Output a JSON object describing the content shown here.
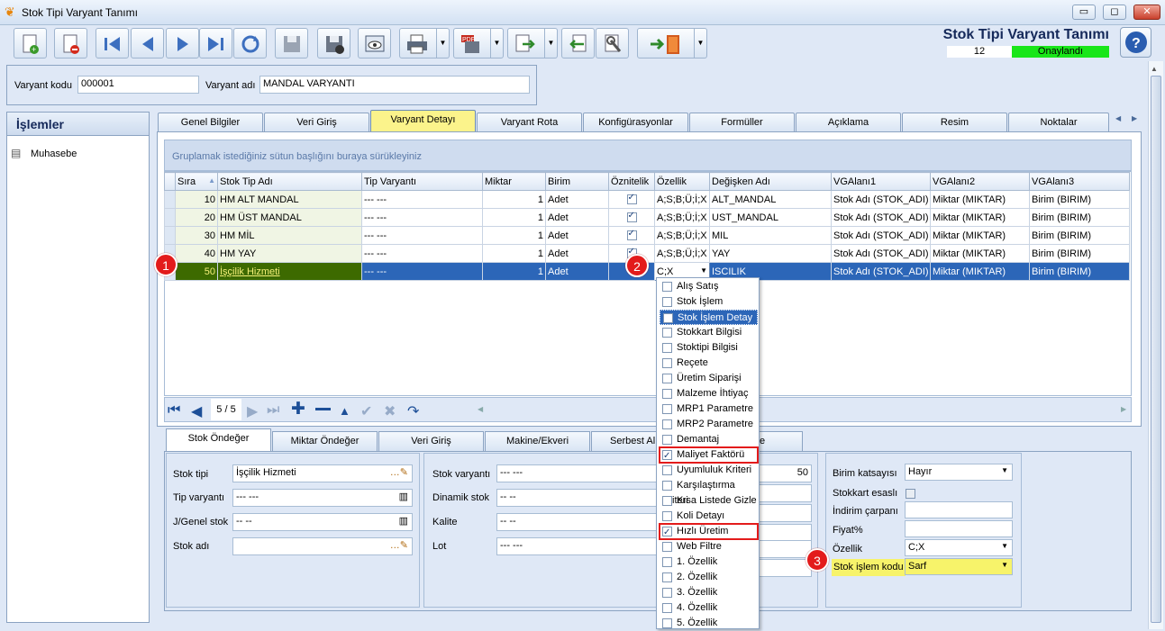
{
  "window": {
    "title": "Stok Tipi Varyant Tanımı",
    "min": "▭",
    "restore": "◻",
    "close": "✕"
  },
  "header": {
    "title": "Stok Tipi Varyant Tanımı",
    "count": "12",
    "status": "Onaylandı",
    "status_color": "#19e619"
  },
  "form": {
    "kod_label": "Varyant kodu",
    "kod_value": "000001",
    "adi_label": "Varyant adı",
    "adi_value": "MANDAL VARYANTI"
  },
  "sidebar": {
    "title": "İşlemler",
    "item": "Muhasebe"
  },
  "tabs": [
    "Genel Bilgiler",
    "Veri Giriş",
    "Varyant Detayı",
    "Varyant Rota",
    "Konfigürasyonlar",
    "Formüller",
    "Açıklama",
    "Resim",
    "Noktalar"
  ],
  "grid": {
    "group_hint": "Gruplamak istediğiniz sütun başlığını buraya sürükleyiniz",
    "columns": [
      "Sıra",
      "Stok Tip Adı",
      "Tip Varyantı",
      "Miktar",
      "Birim",
      "Öznitelik",
      "Özellik",
      "Değişken Adı",
      "VGAlanı1",
      "VGAlanı2",
      "VGAlanı3"
    ],
    "rows": [
      {
        "sira": "10",
        "ad": "HM ALT MANDAL",
        "tip": "--- ---",
        "miktar": "1",
        "birim": "Adet",
        "oz": "A;S;B;Ü;İ;X",
        "deg": "ALT_MANDAL",
        "vg1": "Stok Adı (STOK_ADI)",
        "vg2": "Miktar (MIKTAR)",
        "vg3": "Birim (BIRIM)"
      },
      {
        "sira": "20",
        "ad": "HM ÜST MANDAL",
        "tip": "--- ---",
        "miktar": "1",
        "birim": "Adet",
        "oz": "A;S;B;Ü;İ;X",
        "deg": "UST_MANDAL",
        "vg1": "Stok Adı (STOK_ADI)",
        "vg2": "Miktar (MIKTAR)",
        "vg3": "Birim (BIRIM)"
      },
      {
        "sira": "30",
        "ad": "HM MİL",
        "tip": "--- ---",
        "miktar": "1",
        "birim": "Adet",
        "oz": "A;S;B;Ü;İ;X",
        "deg": "MIL",
        "vg1": "Stok Adı (STOK_ADI)",
        "vg2": "Miktar (MIKTAR)",
        "vg3": "Birim (BIRIM)"
      },
      {
        "sira": "40",
        "ad": "HM YAY",
        "tip": "--- ---",
        "miktar": "1",
        "birim": "Adet",
        "oz": "A;S;B;Ü;İ;X",
        "deg": "YAY",
        "vg1": "Stok Adı (STOK_ADI)",
        "vg2": "Miktar (MIKTAR)",
        "vg3": "Birim (BIRIM)"
      },
      {
        "sira": "50",
        "ad": "İşçilik Hizmeti",
        "tip": "--- ---",
        "miktar": "1",
        "birim": "Adet",
        "oz": "C;X",
        "deg": "ISCILIK",
        "vg1": "Stok Adı (STOK_ADI)",
        "vg2": "Miktar (MIKTAR)",
        "vg3": "Birim (BIRIM)"
      }
    ],
    "pager": "5 / 5"
  },
  "dropdown": [
    {
      "label": "Alış Satış",
      "checked": false
    },
    {
      "label": "Stok İşlem",
      "checked": false
    },
    {
      "label": "Stok İşlem Detay",
      "checked": false,
      "hl": true
    },
    {
      "label": "Stokkart Bilgisi",
      "checked": false
    },
    {
      "label": "Stoktipi Bilgisi",
      "checked": false
    },
    {
      "label": "Reçete",
      "checked": false
    },
    {
      "label": "Üretim Siparişi",
      "checked": false
    },
    {
      "label": "Malzeme İhtiyaç",
      "checked": false
    },
    {
      "label": "MRP1 Parametre",
      "checked": false
    },
    {
      "label": "MRP2 Parametre",
      "checked": false
    },
    {
      "label": "Demantaj",
      "checked": false
    },
    {
      "label": "Maliyet Faktörü",
      "checked": true,
      "box": true
    },
    {
      "label": "Uyumluluk Kriteri",
      "checked": false
    },
    {
      "label": "Karşılaştırma Kriteri",
      "checked": false
    },
    {
      "label": "Kısa Listede Gizle",
      "checked": false
    },
    {
      "label": "Koli Detayı",
      "checked": false
    },
    {
      "label": "Hızlı Üretim",
      "checked": true,
      "box": true
    },
    {
      "label": "Web Filtre",
      "checked": false
    },
    {
      "label": "1. Özellik",
      "checked": false
    },
    {
      "label": "2. Özellik",
      "checked": false
    },
    {
      "label": "3. Özellik",
      "checked": false
    },
    {
      "label": "4. Özellik",
      "checked": false
    },
    {
      "label": "5. Özellik",
      "checked": false
    }
  ],
  "bottom_tabs": [
    "Stok Öndeğer",
    "Miktar Öndeğer",
    "Veri Giriş",
    "Makine/Ekveri",
    "Serbest Al",
    "e"
  ],
  "bottom_left": {
    "stok_tipi_l": "Stok tipi",
    "stok_tipi_v": "İşçilik Hizmeti",
    "tip_var_l": "Tip varyantı",
    "tip_var_v": "--- ---",
    "jgenel_l": "J/Genel stok",
    "jgenel_v": "-- --",
    "stok_adi_l": "Stok adı"
  },
  "bottom_mid": {
    "stok_var_l": "Stok varyantı",
    "stok_var_v": "--- ---",
    "dinamik_l": "Dinamik stok",
    "dinamik_v": "-- --",
    "kalite_l": "Kalite",
    "kalite_v": "-- --",
    "lot_l": "Lot",
    "lot_v": "--- ---",
    "miktar_v": "50"
  },
  "bottom_right": {
    "birim_l": "Birim katsayısı",
    "birim_v": "Hayır",
    "stokkart_l": "Stokkart esaslı",
    "indirim_l": "İndirim çarpanı",
    "fiyat_l": "Fiyat%",
    "ozellik_l": "Özellik",
    "ozellik_v": "C;X",
    "islem_l": "Stok işlem kodu",
    "islem_v": "Sarf"
  },
  "badges": [
    "1",
    "2",
    "3"
  ],
  "colors": {
    "highlight": "#fbf38b",
    "selection": "#2c66b8",
    "callout": "#e31b1b"
  }
}
